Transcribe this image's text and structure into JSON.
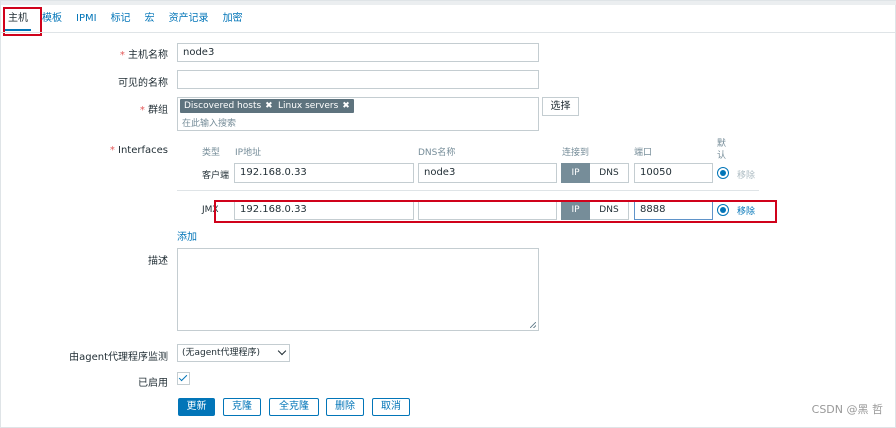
{
  "tabs": [
    "主机",
    "模板",
    "IPMI",
    "标记",
    "宏",
    "资产记录",
    "加密"
  ],
  "form": {
    "hostname_label": "主机名称",
    "hostname_value": "node3",
    "visible_name_label": "可见的名称",
    "visible_name_value": "",
    "groups_label": "群组",
    "groups": [
      "Discovered hosts",
      "Linux servers"
    ],
    "groups_placeholder": "在此输入搜索",
    "select_button": "选择",
    "interfaces_label": "Interfaces",
    "required_mark": "*",
    "interface_headers": {
      "type": "类型",
      "ip": "IP地址",
      "dns": "DNS名称",
      "connect": "连接到",
      "port": "端口",
      "default": "默认"
    },
    "interfaces": [
      {
        "type": "客户端",
        "ip": "192.168.0.33",
        "dns": "node3",
        "ip_btn": "IP",
        "dns_btn": "DNS",
        "port": "10050",
        "remove": "移除",
        "remove_enabled": false
      },
      {
        "type": "JMX",
        "ip": "192.168.0.33",
        "dns": "",
        "ip_btn": "IP",
        "dns_btn": "DNS",
        "port": "8888",
        "remove": "移除",
        "remove_enabled": true
      }
    ],
    "add_link": "添加",
    "description_label": "描述",
    "proxy_label": "由agent代理程序监测",
    "proxy_value": "(无agent代理程序)",
    "enabled_label": "已启用",
    "enabled": true
  },
  "buttons": {
    "update": "更新",
    "clone": "克隆",
    "full_clone": "全克隆",
    "delete": "删除",
    "cancel": "取消"
  },
  "watermark": "CSDN @黑 哲",
  "colors": {
    "accent": "#0275b8",
    "highlight_box": "#d0021b",
    "required": "#e45959"
  }
}
